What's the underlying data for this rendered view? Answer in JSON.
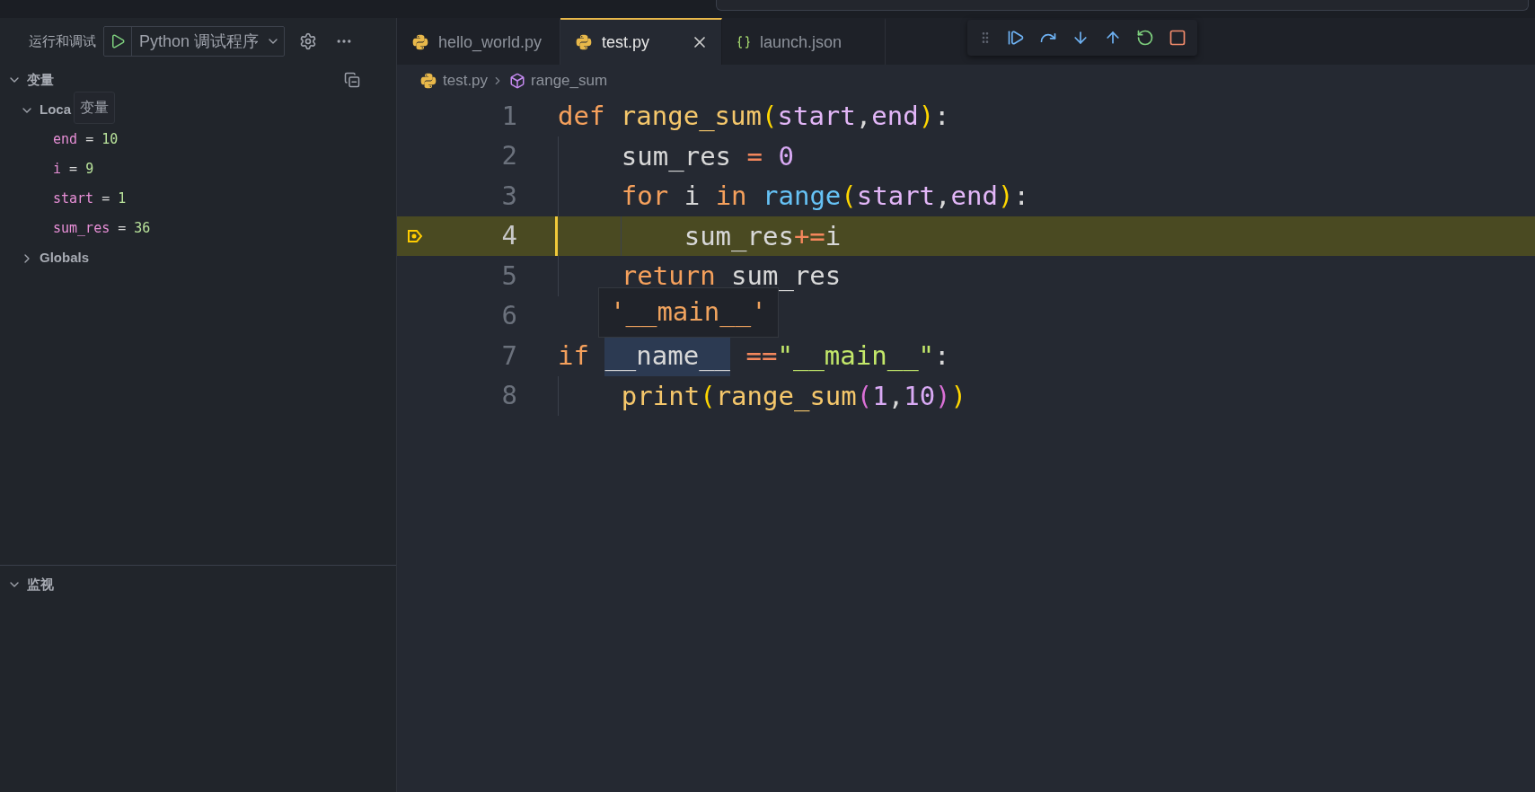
{
  "sidebar": {
    "title": "运行和调试",
    "config": "Python 调试程序",
    "variables": {
      "title": "变量",
      "expanded": true,
      "tooltip": "变量",
      "scopes": [
        {
          "label": "Loca",
          "expanded": true,
          "items": [
            {
              "name": "end",
              "operator": "=",
              "value": "10"
            },
            {
              "name": "i",
              "operator": "=",
              "value": "9"
            },
            {
              "name": "start",
              "operator": "=",
              "value": "1"
            },
            {
              "name": "sum_res",
              "operator": "=",
              "value": "36"
            }
          ]
        },
        {
          "label": "Globals",
          "expanded": false
        }
      ]
    },
    "watch": {
      "title": "监视",
      "expanded": true
    }
  },
  "tabs": [
    {
      "label": "hello_world.py",
      "kind": "python",
      "selected": false
    },
    {
      "label": "test.py",
      "kind": "python",
      "selected": true
    },
    {
      "label": "launch.json",
      "kind": "json",
      "selected": false
    }
  ],
  "breadcrumbs": [
    {
      "label": "test.py",
      "kind": "python"
    },
    {
      "label": "range_sum",
      "kind": "symbol"
    }
  ],
  "code": {
    "lines": [
      {
        "number": "1",
        "current": false,
        "tokens": [
          {
            "text": "def",
            "kind": "keyword"
          },
          {
            "text": " range_sum",
            "kind": "function"
          },
          {
            "text": "(",
            "kind": "bracket1"
          },
          {
            "text": "start",
            "kind": "param"
          },
          {
            "text": ",",
            "kind": "plain"
          },
          {
            "text": "end",
            "kind": "param"
          },
          {
            "text": ")",
            "kind": "bracket1"
          },
          {
            "text": ":",
            "kind": "plain"
          }
        ]
      },
      {
        "number": "2",
        "current": false,
        "tokens": [
          {
            "text": "    sum_res ",
            "kind": "plain"
          },
          {
            "text": "=",
            "kind": "operator"
          },
          {
            "text": " 0",
            "kind": "number"
          }
        ]
      },
      {
        "number": "3",
        "current": false,
        "tokens": [
          {
            "text": "    for",
            "kind": "keyword"
          },
          {
            "text": " i ",
            "kind": "plain"
          },
          {
            "text": "in",
            "kind": "keyword"
          },
          {
            "text": " range",
            "kind": "builtin"
          },
          {
            "text": "(",
            "kind": "bracket1"
          },
          {
            "text": "start",
            "kind": "param"
          },
          {
            "text": ",",
            "kind": "plain"
          },
          {
            "text": "end",
            "kind": "param"
          },
          {
            "text": ")",
            "kind": "bracket1"
          },
          {
            "text": ":",
            "kind": "plain"
          }
        ]
      },
      {
        "number": "4",
        "current": true,
        "tokens": [
          {
            "text": "        sum_res",
            "kind": "plain"
          },
          {
            "text": "+=",
            "kind": "operator"
          },
          {
            "text": "i",
            "kind": "plain"
          }
        ]
      },
      {
        "number": "5",
        "current": false,
        "tokens": [
          {
            "text": "    return",
            "kind": "keyword"
          },
          {
            "text": " sum_res",
            "kind": "plain"
          }
        ]
      },
      {
        "number": "6",
        "current": false,
        "hover": "'__main__'"
      },
      {
        "number": "7",
        "current": false,
        "tokens": [
          {
            "text": "if ",
            "kind": "keyword"
          },
          {
            "text": "__name__",
            "kind": "selected"
          },
          {
            "text": " ==",
            "kind": "operator"
          },
          {
            "text": "\"__main__\"",
            "kind": "string"
          },
          {
            "text": ":",
            "kind": "plain"
          }
        ]
      },
      {
        "number": "8",
        "current": false,
        "tokens": [
          {
            "text": "    print",
            "kind": "function"
          },
          {
            "text": "(",
            "kind": "bracket1"
          },
          {
            "text": "range_sum",
            "kind": "function"
          },
          {
            "text": "(",
            "kind": "bracket2"
          },
          {
            "text": "1",
            "kind": "number"
          },
          {
            "text": ",",
            "kind": "plain"
          },
          {
            "text": "10",
            "kind": "number"
          },
          {
            "text": ")",
            "kind": "bracket2"
          },
          {
            "text": ")",
            "kind": "bracket1"
          }
        ]
      }
    ]
  }
}
